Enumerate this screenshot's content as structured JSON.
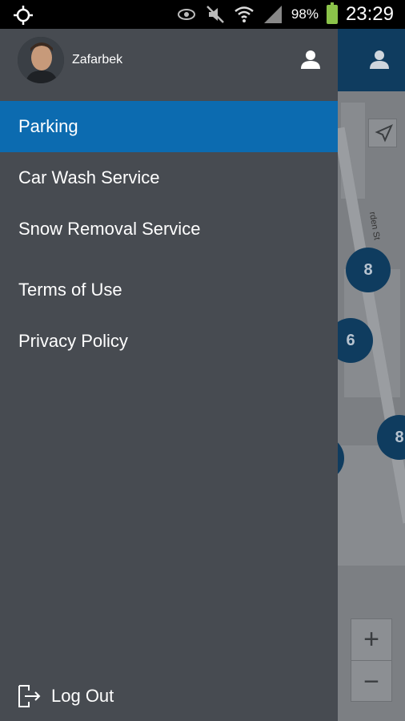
{
  "status_bar": {
    "battery_percent": "98%",
    "battery_level": 0.98,
    "time": "23:29",
    "icons": [
      "gps-icon",
      "eye-icon",
      "mute-icon",
      "wifi-icon",
      "signal-icon",
      "battery-icon"
    ]
  },
  "drawer": {
    "user": {
      "name": "Zafarbek"
    },
    "menu": [
      {
        "label": "Parking",
        "active": true
      },
      {
        "label": "Car Wash Service",
        "active": false
      },
      {
        "label": "Snow Removal Service",
        "active": false
      },
      {
        "label": "Terms of Use",
        "active": false
      },
      {
        "label": "Privacy Policy",
        "active": false
      }
    ],
    "logout_label": "Log Out"
  },
  "map": {
    "street_label": "rden St",
    "markers": [
      "8",
      "6",
      "8"
    ],
    "zoom_in": "+",
    "zoom_out": "−"
  },
  "colors": {
    "drawer_bg": "#474b51",
    "active_item": "#0c6bb0",
    "header_bg": "#0f3c5f",
    "marker_bg": "#0f3c5f"
  }
}
